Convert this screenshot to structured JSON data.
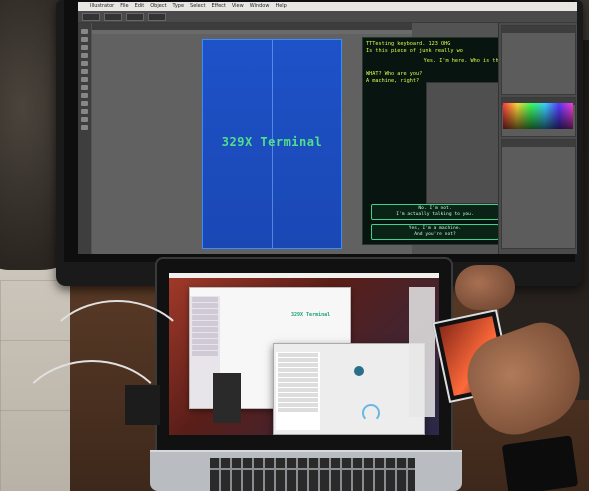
{
  "menubar": {
    "apple": "",
    "items": [
      "Illustrator",
      "File",
      "Edit",
      "Object",
      "Type",
      "Select",
      "Effect",
      "View",
      "Window",
      "Help"
    ]
  },
  "artboard": {
    "title": "329X Terminal"
  },
  "terminal": {
    "lines": [
      "TTTesting keyboard. 123 OHG",
      "Is this piece of junk really wo",
      "Yes. I'm here. Who is this?",
      "WHAT? Who are you?",
      "A machine, right?"
    ],
    "option_1": "No. I'm not.\nI'm actually talking to you.",
    "option_1_line1": "No. I'm not.",
    "option_1_line2": "I'm actually talking to you.",
    "option_2_line1": "Yes, I'm a machine.",
    "option_2_line2": "And you're not?"
  },
  "laptop": {
    "finder_title": "329X Terminal"
  },
  "colors": {
    "artboard_blue": "#1e52c8",
    "terminal_green": "#4fe08c",
    "terminal_text": "#d8ff4a"
  }
}
